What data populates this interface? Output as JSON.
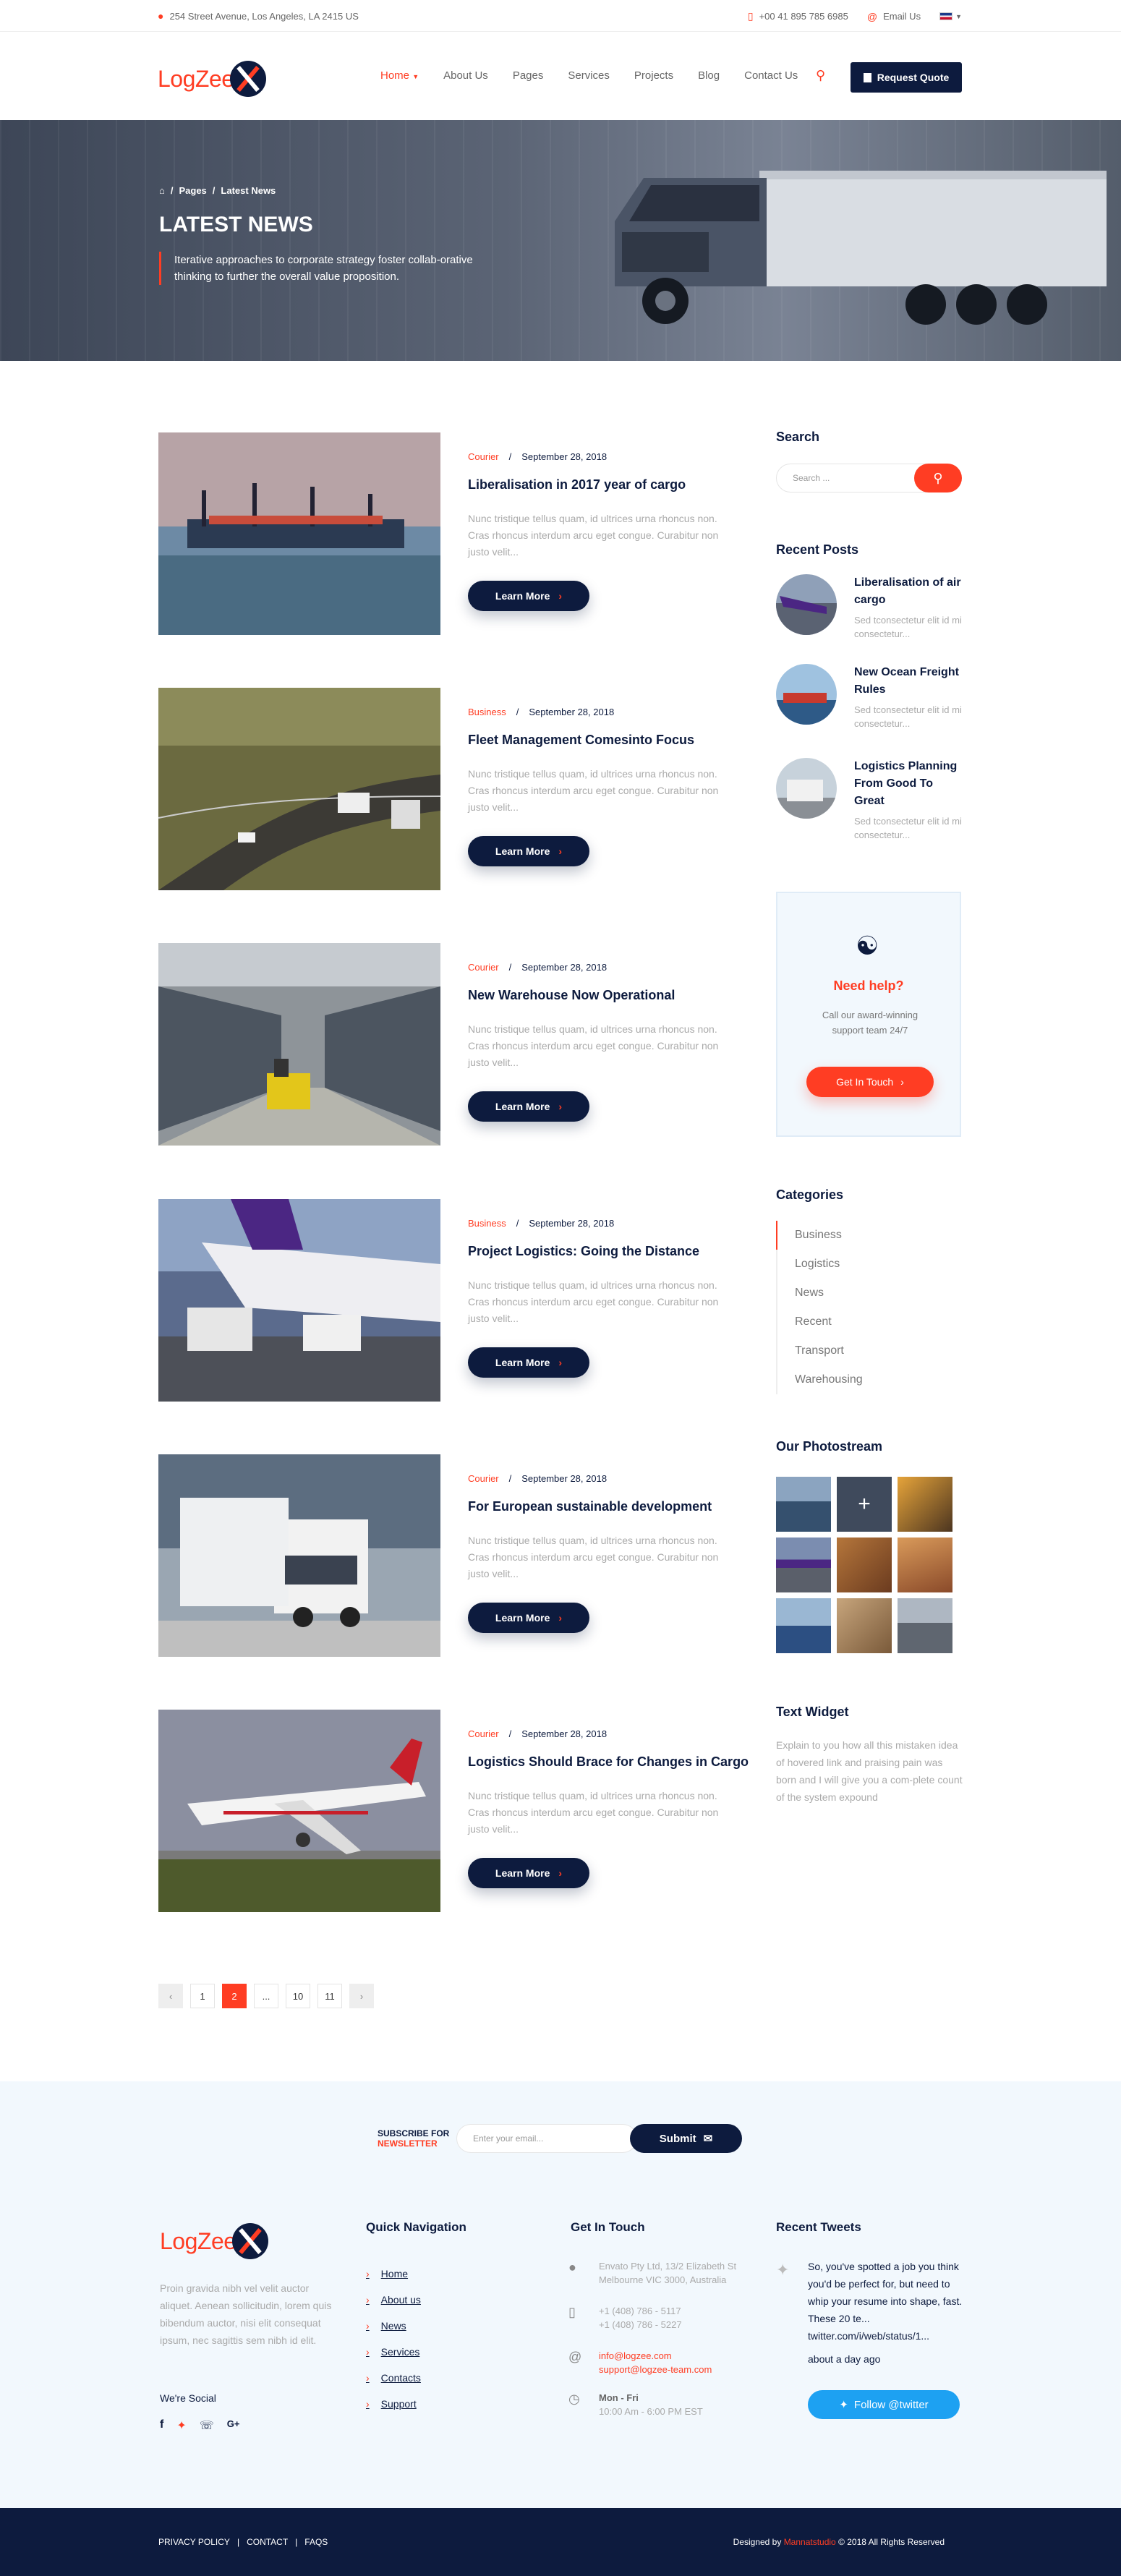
{
  "topbar": {
    "address": "254 Street Avenue, Los Angeles, LA 2415 US",
    "phone": "+00 41 895 785 6985",
    "email": "Email Us"
  },
  "logo": {
    "text": "LogZee"
  },
  "nav": {
    "items": [
      "Home",
      "About Us",
      "Pages",
      "Services",
      "Projects",
      "Blog",
      "Contact Us"
    ],
    "active": "Home",
    "quote_button": "Request Quote"
  },
  "hero": {
    "breadcrumb": [
      "Pages",
      "Latest News"
    ],
    "title": "LATEST NEWS",
    "subtitle": "Iterative approaches to corporate strategy foster collab-orative thinking to further the overall value proposition."
  },
  "posts": [
    {
      "category": "Courier",
      "date": "September 28, 2018",
      "title": "Liberalisation in 2017 year of cargo",
      "excerpt": "Nunc tristique tellus quam, id ultrices urna rhoncus non. Cras rhoncus interdum arcu eget congue. Curabitur non justo velit...",
      "button": "Learn More"
    },
    {
      "category": "Business",
      "date": "September 28, 2018",
      "title": "Fleet Management Comesinto Focus",
      "excerpt": "Nunc tristique tellus quam, id ultrices urna rhoncus non. Cras rhoncus interdum arcu eget congue. Curabitur non justo velit...",
      "button": "Learn More"
    },
    {
      "category": "Courier",
      "date": "September 28, 2018",
      "title": "New Warehouse Now  Operational",
      "excerpt": "Nunc tristique tellus quam, id ultrices urna rhoncus non. Cras rhoncus interdum arcu eget congue. Curabitur non justo velit...",
      "button": "Learn More"
    },
    {
      "category": "Business",
      "date": "September 28, 2018",
      "title": "Project Logistics: Going the  Distance",
      "excerpt": "Nunc tristique tellus quam, id ultrices urna rhoncus non. Cras rhoncus interdum arcu eget congue. Curabitur non justo velit...",
      "button": "Learn More"
    },
    {
      "category": "Courier",
      "date": "September 28, 2018",
      "title": "For European sustainable  development",
      "excerpt": "Nunc tristique tellus quam, id ultrices urna rhoncus non. Cras rhoncus interdum arcu eget congue. Curabitur non justo velit...",
      "button": "Learn More"
    },
    {
      "category": "Courier",
      "date": "September 28, 2018",
      "title": "Logistics Should Brace for Changes  in Cargo",
      "excerpt": "Nunc tristique tellus quam, id ultrices urna rhoncus non. Cras rhoncus interdum arcu eget congue. Curabitur non justo velit...",
      "button": "Learn More"
    }
  ],
  "pagination": {
    "pages": [
      "1",
      "2",
      "...",
      "10",
      "11"
    ],
    "current": "2"
  },
  "sidebar": {
    "search_title": "Search",
    "search_placeholder": "Search ...",
    "recent_title": "Recent Posts",
    "recent": [
      {
        "title": "Liberalisation of air cargo",
        "desc": "Sed tconsectetur elit id mi consectetur..."
      },
      {
        "title": "New Ocean Freight Rules",
        "desc": "Sed tconsectetur elit id mi consectetur..."
      },
      {
        "title": "Logistics Planning From Good To Great",
        "desc": "Sed tconsectetur elit id mi consectetur..."
      }
    ],
    "help": {
      "title": "Need help?",
      "desc": "Call our award-winning support team 24/7",
      "button": "Get In Touch"
    },
    "categories_title": "Categories",
    "categories": [
      "Business",
      "Logistics",
      "News",
      "Recent",
      "Transport",
      "Warehousing"
    ],
    "photostream_title": "Our Photostream",
    "widget_title": "Text Widget",
    "widget_text": "Explain to you how all this mistaken idea of hovered link and praising pain was born and I will give you a com-plete count of the system expound"
  },
  "newsletter": {
    "label_top": "SUBSCRIBE FOR",
    "label_bottom": "NEWSLETTER",
    "placeholder": "Enter your email...",
    "button": "Submit"
  },
  "footer": {
    "about": "Proin gravida nibh vel velit auctor aliquet. Aenean sollicitudin, lorem quis bibendum auctor, nisi elit consequat ipsum, nec sagittis sem nibh id elit.",
    "social_title": "We're Social",
    "quick_title": "Quick Navigation",
    "quick": [
      "Home",
      "About us",
      "News",
      "Services",
      "Contacts",
      "Support"
    ],
    "contact_title": "Get In Touch",
    "address": "Envato Pty Ltd, 13/2 Elizabeth St Melbourne VIC 3000, Australia",
    "phones": "+1 (408) 786 - 5117 +1 (408) 786 - 5227",
    "email1": "info@logzee.com",
    "email2": "support@logzee-team.com",
    "hours_days": "Mon - Fri",
    "hours_time": "10:00 Am - 6:00 PM EST",
    "tweets_title": "Recent Tweets",
    "tweet": "So, you've spotted a job you think you'd be perfect for, but need to whip your resume into shape, fast. These 20 te... twitter.com/i/web/status/1...",
    "tweet_time": "about a day ago",
    "follow": "Follow @twitter"
  },
  "bottom": {
    "links": [
      "PRIVACY POLICY",
      "CONTACT",
      "FAQS"
    ],
    "designed_pre": "Designed by",
    "designed_brand": "Mannatstudio",
    "designed_post": "© 2018 All Rights Reserved"
  },
  "colors": {
    "accent": "#ff3d23",
    "navy": "#0d1b3e",
    "footer_bg": "#f2f8fd",
    "twitter": "#1da1f2"
  }
}
